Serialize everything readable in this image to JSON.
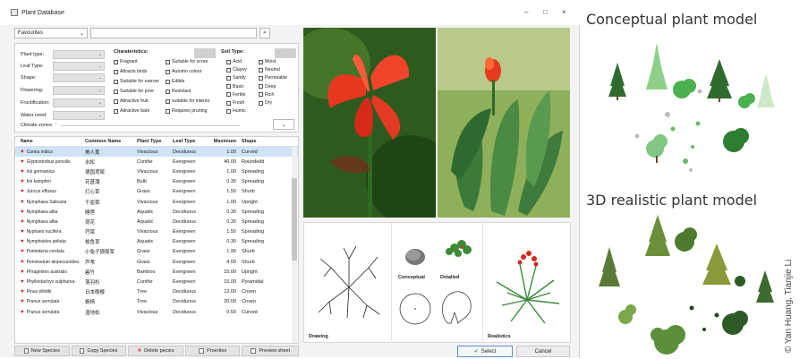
{
  "window": {
    "title": "Plant Database",
    "minimize": "–",
    "maximize": "□",
    "close": "×"
  },
  "toolbar": {
    "favourites": "Favourites",
    "search_value": "",
    "dropdown_glyph": "⌄",
    "search_glyph": "⌕"
  },
  "filters": {
    "fields": [
      {
        "label": "Plant type:"
      },
      {
        "label": "Leaf Type:"
      },
      {
        "label": "Shape:"
      },
      {
        "label": "Flowering:"
      },
      {
        "label": "Fructification:"
      },
      {
        "label": "Water need:"
      }
    ],
    "characteristics_title": "Charateristics:",
    "characteristics": [
      "Fragrant",
      "Attracts birds",
      "Suitable for narrow",
      "Suitable for poor",
      "Attractive fruit",
      "Attractive bark",
      "Suitable for scree",
      "Autumn colour",
      "Edible",
      "Resistant",
      "suitable for interior",
      "Requires pruning"
    ],
    "soil_title": "Soil Type:",
    "soil": [
      "Acid",
      "Clayey",
      "Sandy",
      "Basic",
      "Fertile",
      "Fresh",
      "Humic",
      "Moist",
      "Neutral",
      "Permeable",
      "Deep",
      "Rich",
      "Dry"
    ],
    "climate_label": "Climate zones:",
    "climate_mark": "°",
    "expand_glyph": "⌄"
  },
  "table": {
    "columns": [
      "Name",
      "Common Name",
      "Plant Type",
      "Leaf Type",
      "Maximum",
      "Shape"
    ],
    "rows": [
      [
        "Canna indica",
        "美人蕉",
        "Vivacious",
        "Deciduous",
        "1.00",
        "Curved"
      ],
      [
        "Glyptostrobus pensilis",
        "水松",
        "Conifer",
        "Evergreen",
        "40.00",
        "Roundedd"
      ],
      [
        "Iris germanica",
        "德国鸢尾",
        "Vivacious",
        "Evergreen",
        "1.00",
        "Spreading"
      ],
      [
        "Iris kampferi",
        "花菖蒲",
        "Bulb",
        "Evergreen",
        "0.30",
        "Spreading"
      ],
      [
        "Juncus effusus",
        "灯心草",
        "Grass",
        "Evergreen",
        "1.50",
        "Shurb"
      ],
      [
        "Nymphaea Salicaria",
        "千屈菜",
        "Vivacious",
        "Evergreen",
        "1.00",
        "Upright"
      ],
      [
        "Nymphaea alba",
        "睡莲",
        "Aquatic",
        "Deciduous",
        "0.30",
        "Spreading"
      ],
      [
        "Nymphaea alba",
        "荷花",
        "Aquatic",
        "Deciduous",
        "0.30",
        "Spreading"
      ],
      [
        "Nyphaes nucifera",
        "荇菜",
        "Vivacious",
        "Evergreen",
        "1.50",
        "Spreading"
      ],
      [
        "Nymphoides peltata",
        "梭鱼草",
        "Aquatic",
        "Evergreen",
        "0.30",
        "Spreading"
      ],
      [
        "Pontederia cordata",
        "小兔子狼尾草",
        "Grass",
        "Evergreen",
        "1.90",
        "Shurb"
      ],
      [
        "Pennisetum alopecuroides",
        "芦苇",
        "Grass",
        "Evergreen",
        "4.00",
        "Shurb"
      ],
      [
        "Phragmites australis",
        "箬竹",
        "Bamboo",
        "Evergreen",
        "15.00",
        "Upright"
      ],
      [
        "Phyllostachys sulphurea",
        "落羽杉",
        "Conifer",
        "Evergreen",
        "15.00",
        "Pyramidal"
      ],
      [
        "Pinus elliottii",
        "日本晚樱",
        "Tree",
        "Deciduous",
        "12.00",
        "Crown"
      ],
      [
        "Prunus serrulata",
        "枫杨",
        "Tree",
        "Deciduous",
        "20.00",
        "Crown"
      ],
      [
        "Prunus serrulata",
        "湿地松",
        "Vivacious",
        "Deciduous",
        "0.50",
        "Curved"
      ]
    ]
  },
  "bottom": {
    "new_species": "New Species",
    "copy_species": "Copy Species",
    "delete_species": "Delete pecies",
    "properties": "Proerties",
    "preview": "Preview sheet",
    "select": "Select",
    "cancel": "Cancel",
    "select_glyph": "✓",
    "delete_glyph": "✕"
  },
  "viewer": {
    "drawing": "Drawing",
    "conceptual": "Conceptual",
    "detailed": "Detailed",
    "realistic": "Realistics"
  },
  "captions": {
    "conceptual": "Conceptual plant model",
    "realistic": "3D realistic plant model",
    "credit": "© Yan Huang, Tianjie Li"
  },
  "colors": {
    "accent": "#5a8fd6",
    "selection": "#cfe3f7",
    "heart": "#cc1f1f"
  }
}
